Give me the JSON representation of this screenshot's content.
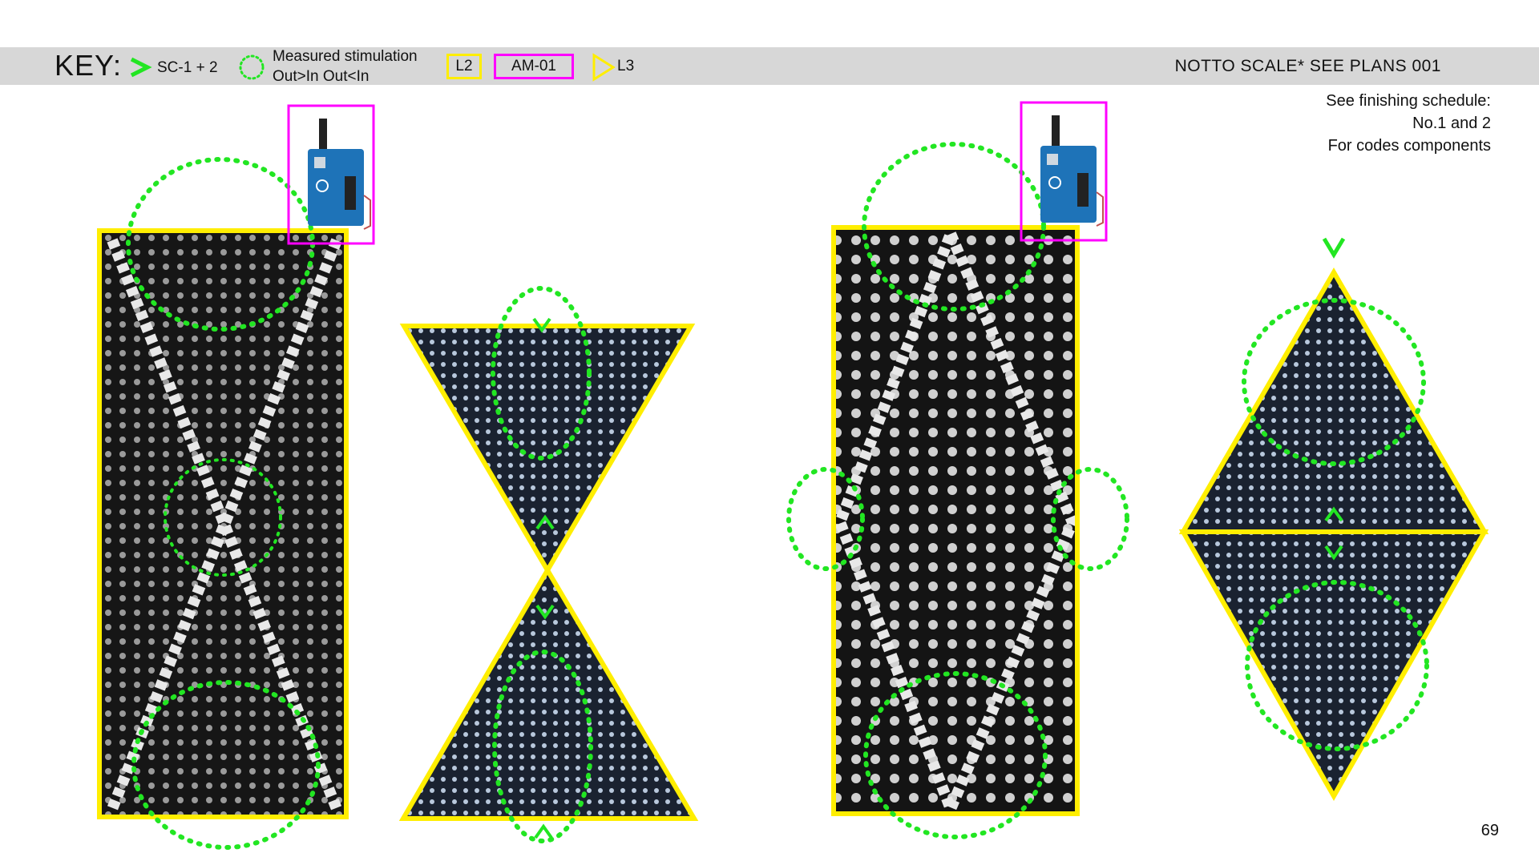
{
  "key": {
    "title": "KEY:",
    "sc_label": "SC-1 + 2",
    "stim_line1": "Measured stimulation",
    "stim_line2": "Out>In Out<In",
    "l2_label": "L2",
    "am_label": "AM-01",
    "l3_label": "L3"
  },
  "header_right": "NOTTO SCALE* SEE PLANS 001",
  "notes": [
    "See finishing schedule:",
    "No.1 and 2",
    "For codes components"
  ],
  "page_number": "69",
  "colors": {
    "l2_yellow": "#ffee00",
    "am_magenta": "#ff00ff",
    "stim_green": "#22e622",
    "key_bar": "#d7d7d7"
  },
  "icons": [
    "arduino-board-icon",
    "chevron-right-icon",
    "triangle-outline-icon"
  ]
}
